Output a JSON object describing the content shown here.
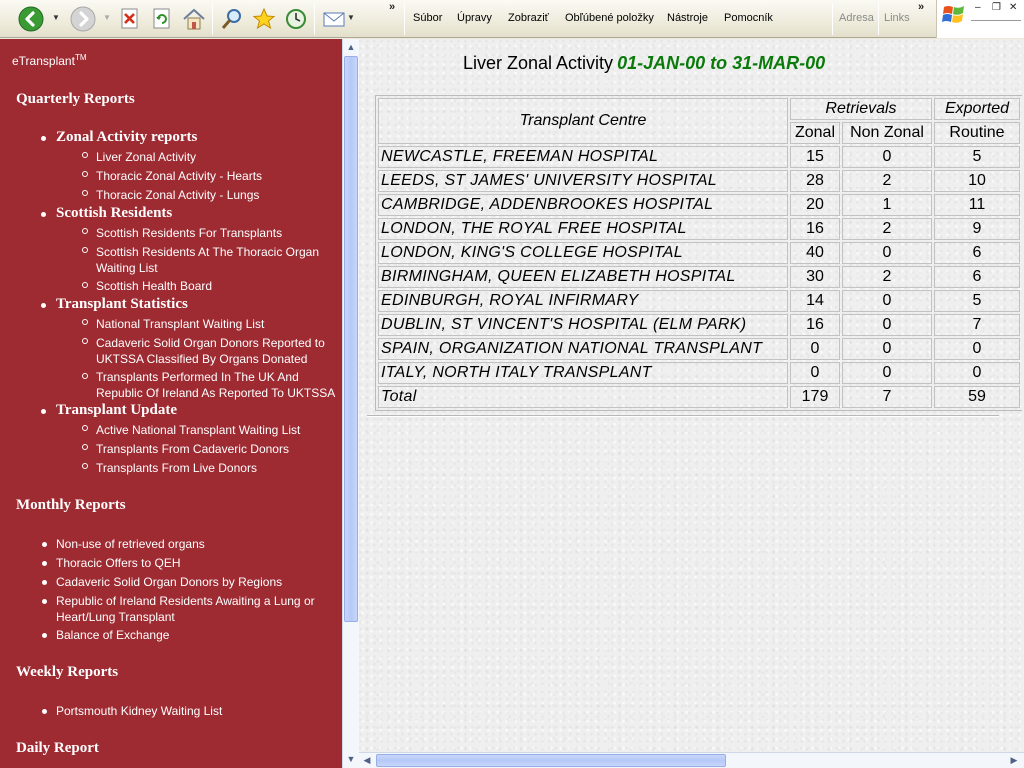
{
  "toolbar": {
    "buttons": [
      {
        "name": "back-icon",
        "glyph": "◀"
      },
      {
        "name": "forward-icon",
        "glyph": "▶"
      },
      {
        "name": "stop-icon",
        "glyph": "✕"
      },
      {
        "name": "refresh-icon",
        "glyph": "↻"
      },
      {
        "name": "home-icon",
        "glyph": "⌂"
      },
      {
        "name": "search-icon",
        "glyph": "⚲"
      },
      {
        "name": "favorites-icon",
        "glyph": "★"
      },
      {
        "name": "history-icon",
        "glyph": "◷"
      },
      {
        "name": "mail-icon",
        "glyph": "✉"
      }
    ],
    "menu": [
      "Súbor",
      "Úpravy",
      "Zobraziť",
      "Obľúbené položky",
      "Nástroje",
      "Pomocník"
    ],
    "address_label": "Adresa",
    "links_label": "Links",
    "chevron": "»"
  },
  "sidebar": {
    "brand": "eTransplant",
    "brand_mark": "TM",
    "quarterly_title": "Quarterly Reports",
    "groups": [
      {
        "title": "Zonal Activity reports",
        "links": [
          "Liver Zonal Activity",
          "Thoracic Zonal Activity - Hearts",
          "Thoracic Zonal Activity - Lungs"
        ]
      },
      {
        "title": "Scottish Residents",
        "links": [
          "Scottish Residents For Transplants",
          "Scottish Residents At The Thoracic Organ Waiting List",
          "Scottish Health Board"
        ]
      },
      {
        "title": "Transplant Statistics",
        "links": [
          "National Transplant Waiting List",
          "Cadaveric Solid Organ Donors Reported to UKTSSA Classified By Organs Donated",
          "Transplants Performed In The UK And Republic Of Ireland As Reported To UKTSSA"
        ]
      },
      {
        "title": "Transplant Update",
        "links": [
          "Active National Transplant Waiting List",
          "Transplants From Cadaveric Donors",
          "Transplants From Live Donors"
        ]
      }
    ],
    "monthly_title": "Monthly Reports",
    "monthly_links": [
      "Non-use of retrieved organs",
      "Thoracic Offers to QEH",
      "Cadaveric Solid Organ Donors by Regions",
      "Republic of Ireland Residents Awaiting a Lung or Heart/Lung Transplant",
      "Balance of Exchange"
    ],
    "weekly_title": "Weekly Reports",
    "weekly_links": [
      "Portsmouth Kidney Waiting List"
    ],
    "daily_title": "Daily Report"
  },
  "report": {
    "title": "Liver Zonal Activity",
    "dates": "01-JAN-00 to 31-MAR-00",
    "headers": {
      "centre": "Transplant Centre",
      "retrievals": "Retrievals",
      "exported": "Exported",
      "zonal": "Zonal",
      "non_zonal": "Non Zonal",
      "routine": "Routine"
    },
    "rows": [
      {
        "centre": "NEWCASTLE, FREEMAN HOSPITAL",
        "zonal": "15",
        "non_zonal": "0",
        "routine": "5"
      },
      {
        "centre": "LEEDS, ST JAMES' UNIVERSITY HOSPITAL",
        "zonal": "28",
        "non_zonal": "2",
        "routine": "10"
      },
      {
        "centre": "CAMBRIDGE, ADDENBROOKES HOSPITAL",
        "zonal": "20",
        "non_zonal": "1",
        "routine": "11"
      },
      {
        "centre": "LONDON, THE ROYAL FREE HOSPITAL",
        "zonal": "16",
        "non_zonal": "2",
        "routine": "9"
      },
      {
        "centre": "LONDON, KING'S COLLEGE HOSPITAL",
        "zonal": "40",
        "non_zonal": "0",
        "routine": "6"
      },
      {
        "centre": "BIRMINGHAM, QUEEN ELIZABETH HOSPITAL",
        "zonal": "30",
        "non_zonal": "2",
        "routine": "6"
      },
      {
        "centre": "EDINBURGH, ROYAL INFIRMARY",
        "zonal": "14",
        "non_zonal": "0",
        "routine": "5"
      },
      {
        "centre": "DUBLIN, ST VINCENT'S HOSPITAL (ELM PARK)",
        "zonal": "16",
        "non_zonal": "0",
        "routine": "7"
      },
      {
        "centre": "SPAIN, ORGANIZATION NATIONAL TRANSPLANT",
        "zonal": "0",
        "non_zonal": "0",
        "routine": "0"
      },
      {
        "centre": "ITALY, NORTH ITALY TRANSPLANT",
        "zonal": "0",
        "non_zonal": "0",
        "routine": "0"
      }
    ],
    "total": {
      "label": "Total",
      "zonal": "179",
      "non_zonal": "7",
      "routine": "59"
    }
  },
  "colors": {
    "sidebar_bg": "#9e2a32",
    "date_green": "#0a7a0a"
  }
}
